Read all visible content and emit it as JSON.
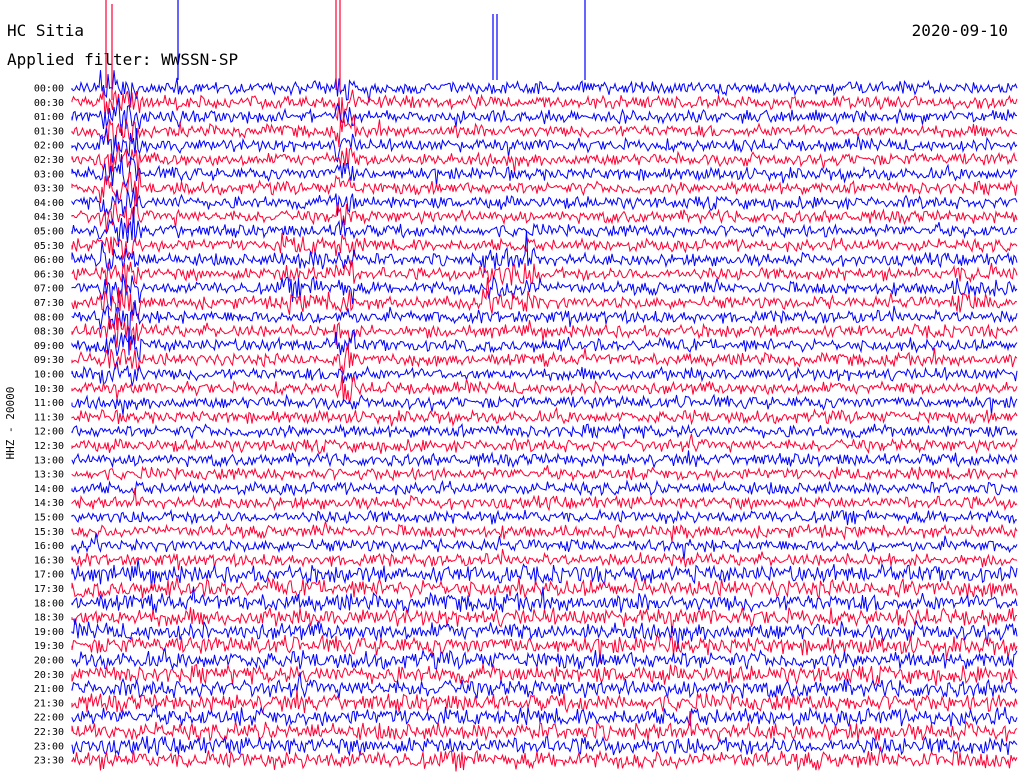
{
  "header": {
    "station": "HC Sitia",
    "date": "2020-09-10",
    "filter": "Applied filter: WWSSN-SP"
  },
  "chart_data": {
    "type": "line",
    "title": "HC Sitia",
    "date": "2020-09-10",
    "filter": "Applied filter: WWSSN-SP",
    "ylabel": "HHZ - 20000",
    "xlabel": "",
    "row_interval_minutes": 30,
    "rows": [
      "00:00",
      "00:30",
      "01:00",
      "01:30",
      "02:00",
      "02:30",
      "03:00",
      "03:30",
      "04:00",
      "04:30",
      "05:00",
      "05:30",
      "06:00",
      "06:30",
      "07:00",
      "07:30",
      "08:00",
      "08:30",
      "09:00",
      "09:30",
      "10:00",
      "10:30",
      "11:00",
      "11:30",
      "12:00",
      "12:30",
      "13:00",
      "13:30",
      "14:00",
      "14:30",
      "15:00",
      "15:30",
      "16:00",
      "16:30",
      "17:00",
      "17:30",
      "18:00",
      "18:30",
      "19:00",
      "19:30",
      "20:00",
      "20:30",
      "21:00",
      "21:30",
      "22:00",
      "22:30",
      "23:00",
      "23:30"
    ],
    "trace_colors": [
      "#0000ff",
      "#ff0033"
    ],
    "grid": false,
    "legend": "none"
  }
}
